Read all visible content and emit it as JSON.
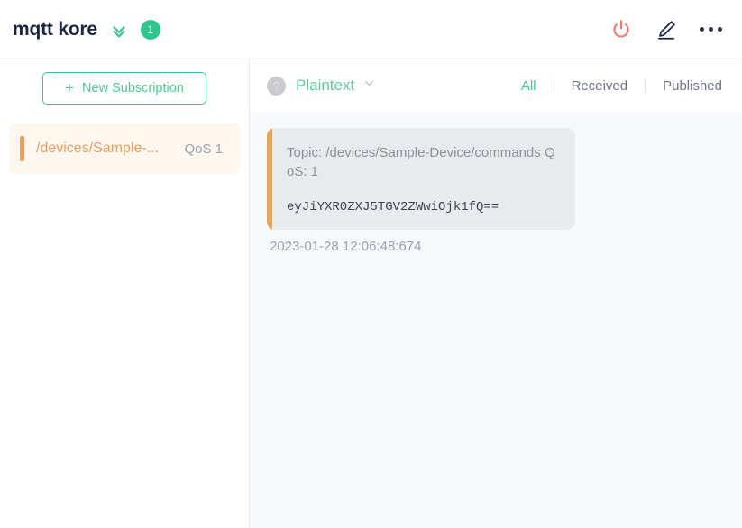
{
  "header": {
    "app_title": "mqtt kore",
    "chevron_icon": "double-chevron-down-icon",
    "badge_count": "1",
    "badge_color": "#2ec68d",
    "power_icon": "power-icon",
    "power_icon_color": "#f4726c",
    "edit_icon": "pencil-edit-icon",
    "edit_icon_color": "#1b2440",
    "more_icon": "more-options-icon"
  },
  "sidebar": {
    "new_subscription_label": "New Subscription",
    "plus_icon": "plus-icon",
    "accent_color": "#3fc48f",
    "subscriptions": [
      {
        "topic": "/devices/Sample-...",
        "qos": "QoS 1",
        "accent_color": "#e5a65c",
        "selected": true
      }
    ]
  },
  "toolbar": {
    "help_icon": "question-mark-icon",
    "help_icon_glyph": "?",
    "format_label": "Plaintext",
    "format_chevron_icon": "chevron-down-icon",
    "format_color": "#5bcd9b",
    "filters": [
      {
        "label": "All",
        "active": true
      },
      {
        "label": "Received",
        "active": false
      },
      {
        "label": "Published",
        "active": false
      }
    ]
  },
  "messages": [
    {
      "meta": "Topic: /devices/Sample-Device/commands    QoS: 1",
      "payload": "eyJiYXR0ZXJ5TGV2ZWwiOjk1fQ==",
      "timestamp": "2023-01-28 12:06:48:674",
      "accent_color": "#e5a65c"
    }
  ]
}
